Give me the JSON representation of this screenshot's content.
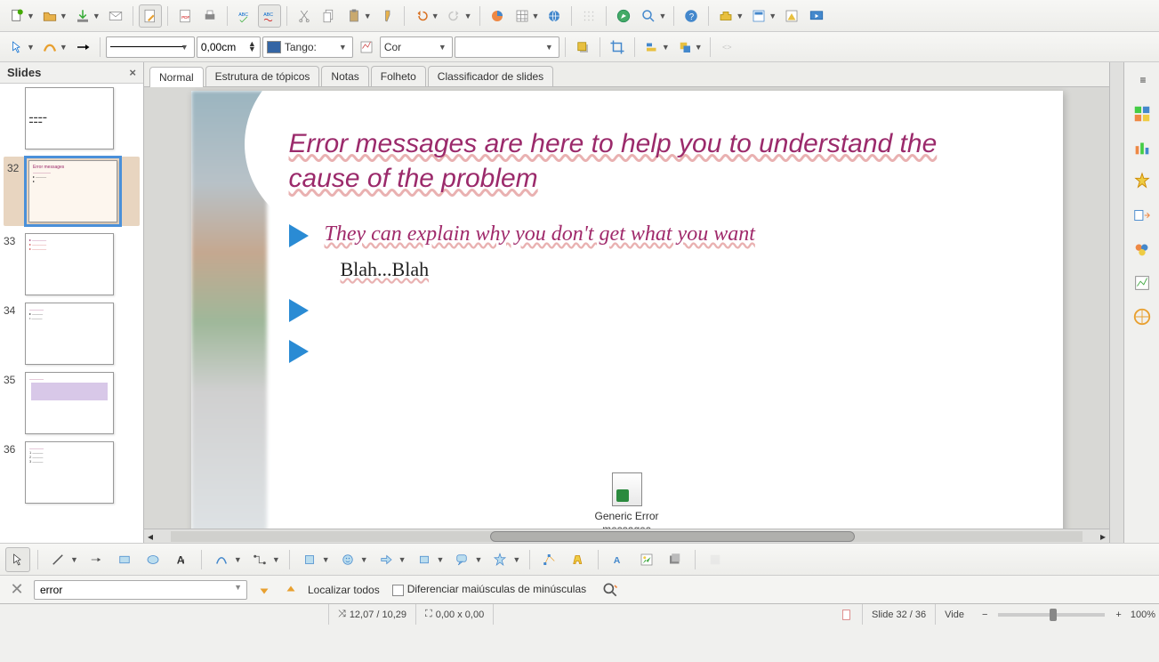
{
  "toolbar1": {
    "line_width": "0,00cm",
    "color_name": "Tango:",
    "transparency_label": "Cor"
  },
  "slidesPanel": {
    "title": "Slides",
    "thumbs": [
      {
        "num": "",
        "selected": false
      },
      {
        "num": "32",
        "selected": true
      },
      {
        "num": "33",
        "selected": false
      },
      {
        "num": "34",
        "selected": false
      },
      {
        "num": "35",
        "selected": false
      },
      {
        "num": "36",
        "selected": false
      }
    ]
  },
  "tabs": {
    "items": [
      "Normal",
      "Estrutura de tópicos",
      "Notas",
      "Folheto",
      "Classificador de slides"
    ],
    "active": 0
  },
  "slide": {
    "title": "Error messages are here to help you to understand the cause of the problem",
    "bullet1": "They can explain why you don't get what you want",
    "sub1": "Blah...Blah",
    "embed_label1": "Generic Error",
    "embed_label2": "messages"
  },
  "findbar": {
    "value": "error",
    "find_all_label": "Localizar todos",
    "match_case_label": "Diferenciar maiúsculas de minúsculas"
  },
  "status": {
    "coords": "12,07 / 10,29",
    "size": "0,00 x 0,00",
    "slide_num": "Slide 32 / 36",
    "master": "Vide",
    "zoom": "100%"
  }
}
